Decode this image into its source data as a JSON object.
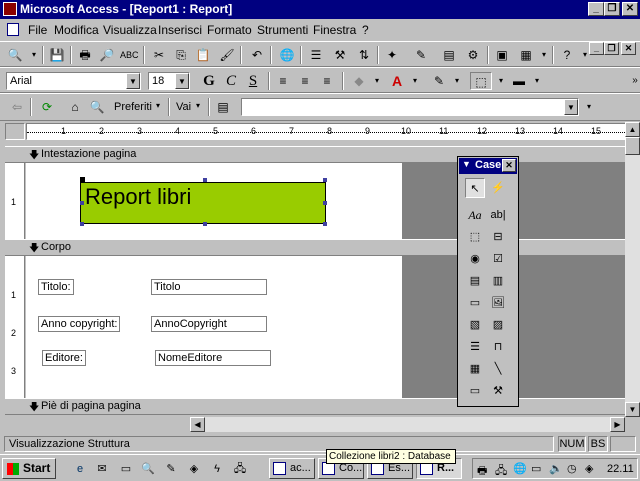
{
  "window": {
    "title": "Microsoft Access - [Report1 : Report]",
    "min": "_",
    "max": "❐",
    "close": "✕"
  },
  "menu": {
    "items": [
      "File",
      "Modifica",
      "Visualizza",
      "Inserisci",
      "Formato",
      "Strumenti",
      "Finestra",
      "?"
    ]
  },
  "format_toolbar": {
    "font": "Arial",
    "size": "18",
    "bold": "G",
    "italic": "C",
    "underline": "S",
    "font_color_letter": "A"
  },
  "web_toolbar": {
    "favorites": "Preferiti",
    "goto": "Vai"
  },
  "ruler": {
    "ticks": [
      "1",
      "2",
      "3",
      "4",
      "5",
      "6",
      "7",
      "8",
      "9",
      "10",
      "11",
      "12",
      "13",
      "14",
      "15"
    ]
  },
  "report": {
    "sections": {
      "header": "Intestazione pagina",
      "body": "Corpo",
      "footer": "Piè di pagina pagina"
    },
    "title": "Report libri",
    "fields": [
      {
        "label": "Titolo:",
        "value": "Titolo"
      },
      {
        "label": "Anno copyright:",
        "value": "AnnoCopyright"
      },
      {
        "label": "Editore:",
        "value": "NomeEditore"
      }
    ]
  },
  "toolbox": {
    "title": "Case",
    "close": "✕",
    "text_glyph": "Aa",
    "textbox_glyph": "ab|"
  },
  "statusbar": {
    "text": "Visualizzazione Struttura",
    "num": "NUM",
    "bs": "BS"
  },
  "tooltip": "Collezione libri2 : Database",
  "taskbar": {
    "start": "Start",
    "tasks": [
      "ac...",
      "Co...",
      "Es...",
      "R..."
    ],
    "clock": "22.11"
  }
}
